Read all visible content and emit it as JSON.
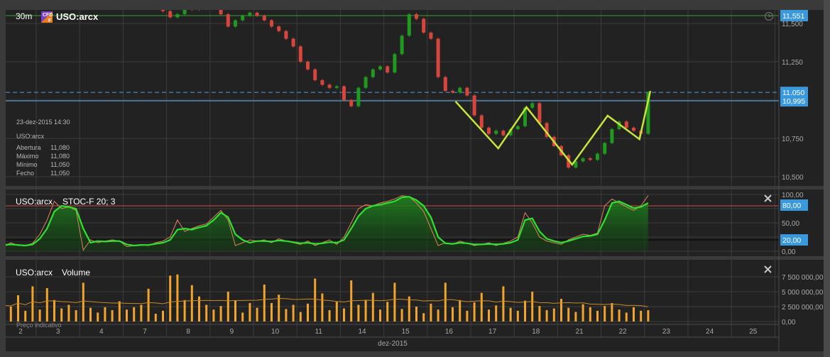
{
  "header": {
    "interval": "30m",
    "badge": "CFD F",
    "symbol": "USO:arcx"
  },
  "info_box": {
    "datetime": "23-dez-2015 14:30",
    "symbol": "USO:arcx",
    "rows": [
      {
        "label": "Abertura",
        "value": "11,080"
      },
      {
        "label": "Máximo",
        "value": "11,080"
      },
      {
        "label": "Mínimo",
        "value": "11,050"
      },
      {
        "label": "Fecho",
        "value": "11,050"
      }
    ]
  },
  "stoch_panel": {
    "symbol": "USO:arcx",
    "indicator": "STOC-F 20; 3"
  },
  "volume_panel": {
    "symbol": "USO:arcx",
    "indicator": "Volume",
    "footnote": "Preço indicativo"
  },
  "x_axis": {
    "days": [
      "2",
      "3",
      "4",
      "7",
      "8",
      "9",
      "10",
      "11",
      "14",
      "15",
      "16",
      "17",
      "18",
      "21",
      "22",
      "23",
      "24",
      "25"
    ],
    "month": "dez-2015"
  },
  "icons": {
    "clock": "clock-icon",
    "close": "close-icon",
    "badge": "cfd-badge-icon"
  },
  "colors": {
    "up": "#1f9a1f",
    "down": "#d8453c",
    "stoch_k": "#d9855a",
    "stoch_d": "#2fe02f",
    "volume": "#f2a52a",
    "tag": "#3a98dc",
    "drawing": "#c8e63a"
  },
  "chart_data": [
    {
      "type": "candlestick",
      "interval": "30m",
      "ylim": [
        10450,
        11600
      ],
      "price_ticks": [
        "11,500",
        "11,250",
        "10,750",
        "10,500"
      ],
      "price_tick_values": [
        11500,
        11250,
        10750,
        10500
      ],
      "levels": [
        {
          "label": "11,551",
          "value": 11551,
          "style": "solid-green"
        },
        {
          "label": "11,050",
          "value": 11050,
          "style": "dashed-blue"
        },
        {
          "label": "10,995",
          "value": 10995,
          "style": "solid-blue"
        }
      ],
      "closes": [
        11800,
        11780,
        11760,
        11790,
        11770,
        11750,
        11780,
        11820,
        11800,
        11760,
        11740,
        11720,
        11700,
        11720,
        11680,
        11700,
        11720,
        11690,
        11680,
        11650,
        11640,
        11620,
        11600,
        11580,
        11540,
        11560,
        11600,
        11590,
        11610,
        11620,
        11610,
        11560,
        11480,
        11520,
        11550,
        11570,
        11550,
        11520,
        11480,
        11450,
        11400,
        11350,
        11250,
        11200,
        11130,
        11100,
        11080,
        11090,
        11000,
        10960,
        11080,
        11150,
        11200,
        11220,
        11180,
        11300,
        11420,
        11560,
        11530,
        11440,
        11400,
        11150,
        11060,
        11050,
        11080,
        11030,
        10900,
        10820,
        10780,
        10800,
        10770,
        10810,
        10830,
        10950,
        10980,
        10850,
        10760,
        10700,
        10640,
        10560,
        10600,
        10620,
        10610,
        10650,
        10720,
        10810,
        10860,
        10820,
        10800,
        10780,
        11050
      ],
      "drawing_zigzag": [
        {
          "bar": 63.4,
          "price": 10991
        },
        {
          "bar": 69.3,
          "price": 10685
        },
        {
          "bar": 73.2,
          "price": 10954
        },
        {
          "bar": 79.5,
          "price": 10579
        },
        {
          "bar": 84.4,
          "price": 10898
        },
        {
          "bar": 88.8,
          "price": 10745
        },
        {
          "bar": 90.3,
          "price": 11060
        }
      ]
    },
    {
      "type": "line",
      "title": "STOC-F 20; 3",
      "ylim": [
        0,
        100
      ],
      "ticks": [
        "100,00",
        "50,00",
        "0,00"
      ],
      "tick_values": [
        100,
        50,
        0
      ],
      "levels": [
        {
          "label": "80,00",
          "value": 80
        },
        {
          "label": "20,00",
          "value": 20
        }
      ],
      "series": [
        {
          "key": "k",
          "values": [
            12,
            8,
            15,
            10,
            10,
            14,
            30,
            55,
            88,
            75,
            78,
            72,
            2,
            20,
            15,
            18,
            20,
            18,
            8,
            10,
            12,
            10,
            15,
            18,
            25,
            55,
            35,
            40,
            45,
            48,
            60,
            72,
            55,
            10,
            15,
            20,
            18,
            20,
            15,
            22,
            18,
            15,
            12,
            18,
            10,
            15,
            20,
            12,
            25,
            50,
            75,
            82,
            80,
            85,
            88,
            92,
            98,
            96,
            85,
            70,
            40,
            10,
            15,
            12,
            18,
            14,
            10,
            12,
            15,
            10,
            14,
            18,
            25,
            68,
            50,
            25,
            18,
            15,
            12,
            20,
            25,
            30,
            28,
            32,
            80,
            92,
            85,
            78,
            72,
            80,
            98
          ]
        },
        {
          "key": "d",
          "values": [
            14,
            11,
            12,
            11,
            10,
            12,
            22,
            40,
            70,
            80,
            78,
            75,
            40,
            15,
            18,
            17,
            18,
            18,
            12,
            10,
            11,
            11,
            13,
            15,
            20,
            38,
            40,
            38,
            42,
            45,
            55,
            68,
            60,
            30,
            20,
            15,
            18,
            18,
            17,
            19,
            18,
            16,
            14,
            15,
            13,
            14,
            16,
            15,
            20,
            40,
            62,
            75,
            80,
            82,
            85,
            88,
            95,
            96,
            90,
            80,
            60,
            25,
            14,
            13,
            15,
            14,
            12,
            12,
            13,
            12,
            13,
            15,
            20,
            55,
            58,
            35,
            22,
            18,
            15,
            18,
            22,
            26,
            27,
            30,
            55,
            85,
            88,
            82,
            76,
            78,
            85
          ]
        }
      ]
    },
    {
      "type": "bar",
      "title": "Volume",
      "ylim": [
        0,
        9000000
      ],
      "ticks": [
        "7 500 000,00",
        "5 000 000,00",
        "2 500 000,00",
        "0,00"
      ],
      "tick_values": [
        7500000,
        5000000,
        2500000,
        0
      ],
      "values_millions": [
        3.1,
        2.3,
        2.5,
        4.4,
        1.8,
        5.9,
        2.0,
        5.6,
        3.6,
        2.2,
        2.8,
        1.9,
        6.5,
        2.3,
        1.5,
        2.4,
        1.9,
        3.4,
        2.0,
        2.4,
        2.8,
        5.5,
        1.3,
        1.8,
        7.7,
        7.9,
        3.6,
        6.1,
        4.2,
        2.8,
        2.0,
        2.6,
        5.0,
        3.5,
        1.5,
        3.1,
        2.3,
        6.2,
        3.1,
        4.5,
        2.1,
        2.8,
        1.6,
        3.0,
        7.2,
        4.7,
        1.9,
        3.3,
        2.2,
        6.9,
        2.8,
        3.6,
        4.8,
        2.0,
        3.3,
        6.5,
        2.1,
        4.2,
        2.5,
        1.4,
        3.0,
        2.0,
        6.5,
        2.4,
        3.6,
        1.8,
        3.2,
        4.8,
        2.0,
        2.7,
        5.9,
        2.3,
        1.8,
        3.5,
        5.0,
        2.6,
        1.9,
        2.2,
        3.8,
        2.3,
        1.6,
        2.9,
        2.4,
        1.8,
        2.6,
        3.1,
        2.0,
        1.5,
        2.4,
        1.8,
        1.9
      ]
    }
  ]
}
